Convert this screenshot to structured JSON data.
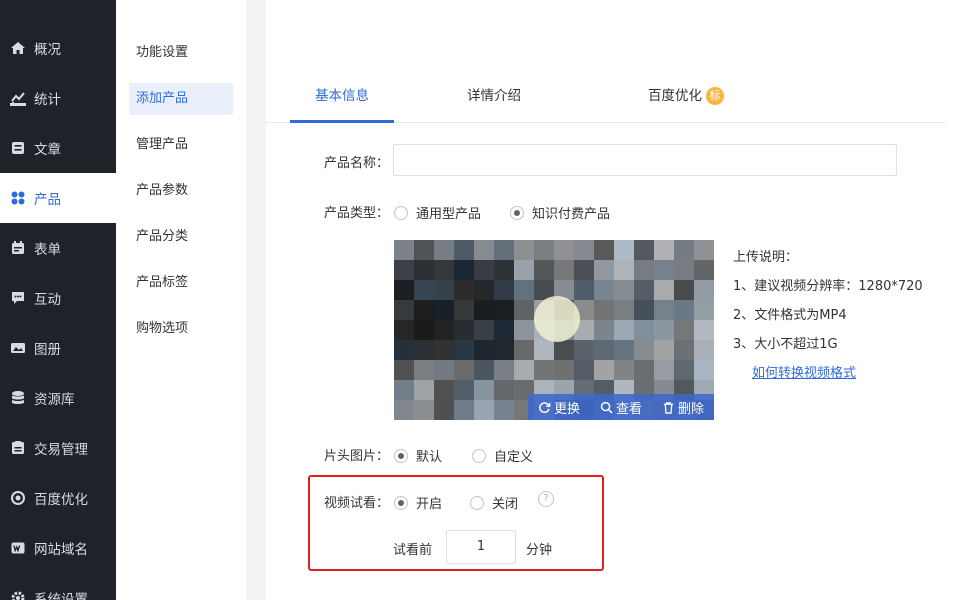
{
  "sidebar": {
    "items": [
      {
        "label": "概况",
        "icon": "home-icon"
      },
      {
        "label": "统计",
        "icon": "stats-icon"
      },
      {
        "label": "文章",
        "icon": "article-icon"
      },
      {
        "label": "产品",
        "icon": "product-icon"
      },
      {
        "label": "表单",
        "icon": "form-icon"
      },
      {
        "label": "互动",
        "icon": "chat-icon"
      },
      {
        "label": "图册",
        "icon": "gallery-icon"
      },
      {
        "label": "资源库",
        "icon": "database-icon"
      },
      {
        "label": "交易管理",
        "icon": "trade-icon"
      },
      {
        "label": "百度优化",
        "icon": "seo-icon"
      },
      {
        "label": "网站域名",
        "icon": "domain-icon"
      },
      {
        "label": "系统设置",
        "icon": "settings-icon"
      }
    ],
    "active_index": 3
  },
  "submenu": {
    "items": [
      "功能设置",
      "添加产品",
      "管理产品",
      "产品参数",
      "产品分类",
      "产品标签",
      "购物选项"
    ],
    "active_index": 1
  },
  "tabs": {
    "items": [
      "基本信息",
      "详情介绍",
      "百度优化"
    ],
    "badge": "标",
    "active_index": 0
  },
  "form": {
    "name_label": "产品名称：",
    "name_value": "",
    "type_label": "产品类型：",
    "type_options": [
      "通用型产品",
      "知识付费产品"
    ],
    "type_selected": 1,
    "video_actions": [
      "更换",
      "查看",
      "删除"
    ],
    "upload_notes": {
      "title": "上传说明：",
      "lines": [
        "1、建议视频分辨率：1280*720",
        "2、文件格式为MP4",
        "3、大小不超过1G"
      ],
      "link": "如何转换视频格式"
    },
    "cover_label": "片头图片：",
    "cover_options": [
      "默认",
      "自定义"
    ],
    "cover_selected": 0,
    "preview_label": "视频试看：",
    "preview_options": [
      "开启",
      "关闭"
    ],
    "preview_selected": 0,
    "help_text": "?",
    "trial_prefix": "试看前",
    "trial_value": "1",
    "trial_unit": "分钟"
  },
  "colors": {
    "accent": "#2f6bd8",
    "sidebar_bg": "#1f2329",
    "highlight_box": "#e02020",
    "badge": "#f5b53f"
  }
}
